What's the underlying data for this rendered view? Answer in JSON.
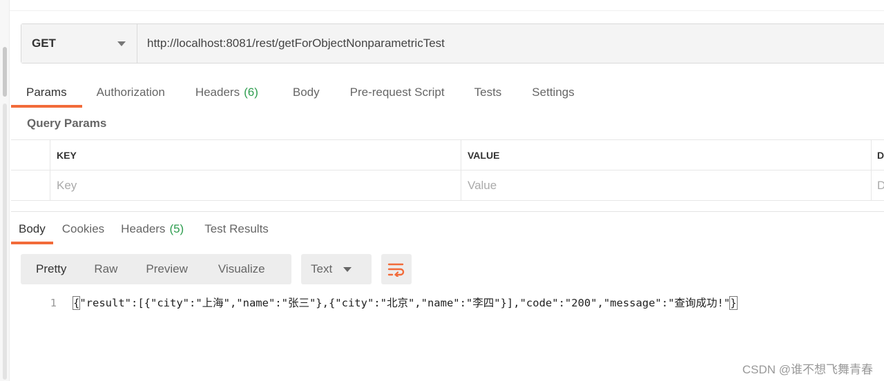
{
  "request": {
    "method": "GET",
    "url": "http://localhost:8081/rest/getForObjectNonparametricTest"
  },
  "request_tabs": [
    {
      "label": "Params",
      "count": "",
      "active": true
    },
    {
      "label": "Authorization",
      "count": "",
      "active": false
    },
    {
      "label": "Headers",
      "count": "(6)",
      "active": false
    },
    {
      "label": "Body",
      "count": "",
      "active": false
    },
    {
      "label": "Pre-request Script",
      "count": "",
      "active": false
    },
    {
      "label": "Tests",
      "count": "",
      "active": false
    },
    {
      "label": "Settings",
      "count": "",
      "active": false
    }
  ],
  "query_params": {
    "title": "Query Params",
    "columns": [
      "KEY",
      "VALUE",
      "D"
    ],
    "placeholders": {
      "key": "Key",
      "value": "Value",
      "description": "D"
    }
  },
  "response_tabs": [
    {
      "label": "Body",
      "count": "",
      "active": true
    },
    {
      "label": "Cookies",
      "count": "",
      "active": false
    },
    {
      "label": "Headers",
      "count": "(5)",
      "active": false
    },
    {
      "label": "Test Results",
      "count": "",
      "active": false
    }
  ],
  "response_view": {
    "modes": [
      "Pretty",
      "Raw",
      "Preview",
      "Visualize"
    ],
    "active_mode": "Pretty",
    "format": "Text",
    "wrap_icon": "wrap-lines-icon"
  },
  "response_body": {
    "line_number": "1",
    "open_brace": "{",
    "middle": "\"result\":[{\"city\":\"上海\",\"name\":\"张三\"},{\"city\":\"北京\",\"name\":\"李四\"}],\"code\":\"200\",\"message\":\"查询成功!\"",
    "close_brace": "}"
  },
  "watermark": "CSDN @谁不想飞舞青春",
  "colors": {
    "accent": "#f26b3a",
    "count_green": "#2e9d4f"
  }
}
